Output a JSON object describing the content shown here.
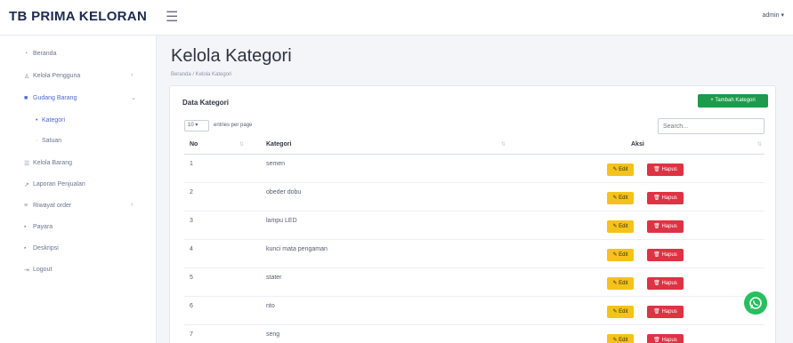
{
  "brand": "TB PRIMA KELORAN",
  "user_menu": "admin ▾",
  "sidebar": {
    "items": [
      {
        "label": "Beranda",
        "icon": "speedometer-icon"
      },
      {
        "label": "Kelola Pengguna",
        "icon": "users-icon",
        "chevron": "›"
      },
      {
        "label": "Gudang Barang",
        "icon": "box-icon",
        "chevron": "⌄"
      },
      {
        "label": "Kategori",
        "icon": "circle-icon"
      },
      {
        "label": "Satuan",
        "icon": "circle-icon"
      },
      {
        "label": "Kelola Barang",
        "icon": "list-icon"
      },
      {
        "label": "Laporan Penjualan",
        "icon": "chart-icon"
      },
      {
        "label": "Riwayat order",
        "icon": "history-icon",
        "chevron": "›"
      },
      {
        "label": "Payara",
        "icon": "card-icon"
      },
      {
        "label": "Deskripsi",
        "icon": "info-icon"
      },
      {
        "label": "Logout",
        "icon": "logout-icon"
      }
    ]
  },
  "page": {
    "title": "Kelola Kategori",
    "breadcrumb": "Beranda / Kelola Kategori"
  },
  "card": {
    "title": "Data Kategori",
    "add_button": "+ Tambah Kategori",
    "length_value": "10 ▾",
    "length_label": "entries per page",
    "search_placeholder": "Search..."
  },
  "table": {
    "headers": {
      "no": "No",
      "kategori": "Kategori",
      "aksi": "Aksi"
    },
    "edit_label": "✎ Edit",
    "delete_label": "🗑 Hapus",
    "rows": [
      {
        "no": "1",
        "kategori": "semen"
      },
      {
        "no": "2",
        "kategori": "obeder dobu"
      },
      {
        "no": "3",
        "kategori": "lampu LED"
      },
      {
        "no": "4",
        "kategori": "kunci mata pengaman"
      },
      {
        "no": "5",
        "kategori": "stater"
      },
      {
        "no": "6",
        "kategori": "nto"
      },
      {
        "no": "7",
        "kategori": "seng"
      }
    ]
  },
  "colors": {
    "accent": "#4d68d8",
    "add_button": "#1d9a4b",
    "edit_button": "#f4c21b",
    "delete_button": "#dd3343",
    "whatsapp": "#25c05f"
  }
}
